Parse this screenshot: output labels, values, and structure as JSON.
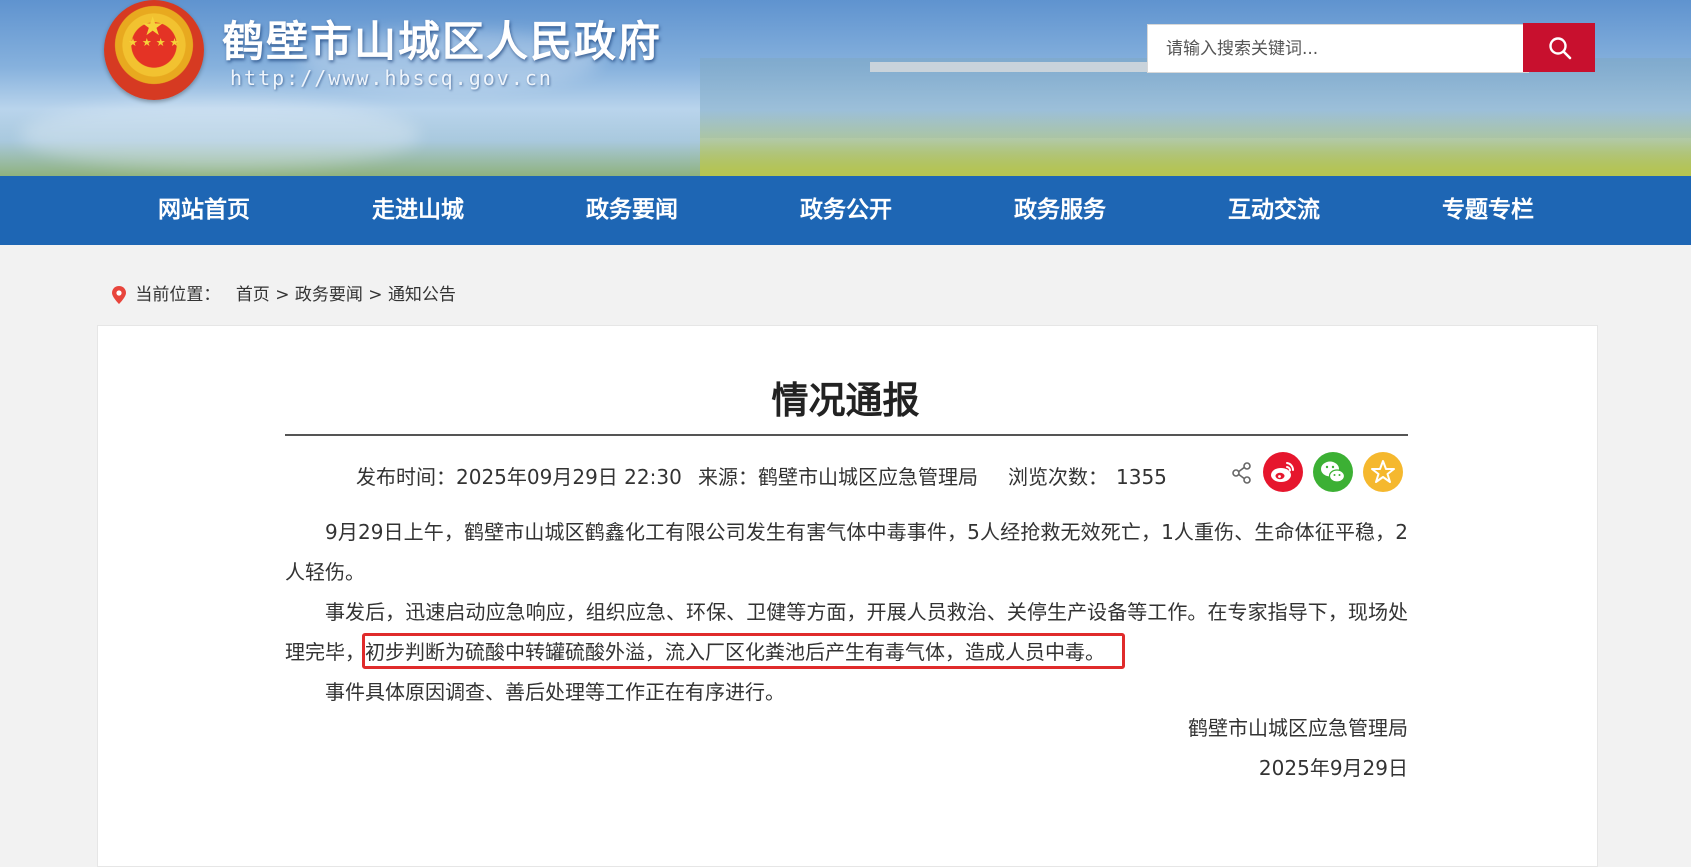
{
  "header": {
    "site_title": "鹤壁市山城区人民政府",
    "site_url": "http://www.hbscq.gov.cn",
    "search_placeholder": "请输入搜索关键词..."
  },
  "nav": {
    "items": [
      "网站首页",
      "走进山城",
      "政务要闻",
      "政务公开",
      "政务服务",
      "互动交流",
      "专题专栏"
    ]
  },
  "breadcrumb": {
    "label": "当前位置：",
    "home": "首页",
    "sep": ">",
    "section": "政务要闻",
    "current": "通知公告"
  },
  "article": {
    "title": "情况通报",
    "publish_time": "发布时间：2025年09月29日 22:30",
    "source": "来源：鹤壁市山城区应急管理局",
    "views_label": "浏览次数：",
    "views": "1355",
    "para1": "9月29日上午，鹤壁市山城区鹤鑫化工有限公司发生有害气体中毒事件，5人经抢救无效死亡，1人重伤、生命体征平稳，2人轻伤。",
    "para2": "事发后，迅速启动应急响应，组织应急、环保、卫健等方面，开展人员救治、关停生产设备等工作。在专家指导下，现场处理完毕，初步判断为硫酸中转罐硫酸外溢，流入厂区化粪池后产生有毒气体，造成人员中毒。",
    "para3": "事件具体原因调查、善后处理等工作正在有序进行。",
    "sign_org": "鹤壁市山城区应急管理局",
    "sign_date": "2025年9月29日"
  },
  "share": {
    "icons": [
      "share-icon",
      "weibo-icon",
      "wechat-icon",
      "favorite-icon"
    ]
  },
  "colors": {
    "nav_bg": "#1e66b4",
    "search_btn": "#c8102e",
    "highlight_border": "#e02b2b",
    "weibo": "#e6162d",
    "wechat": "#3cb034",
    "favorite": "#f5b82e"
  }
}
